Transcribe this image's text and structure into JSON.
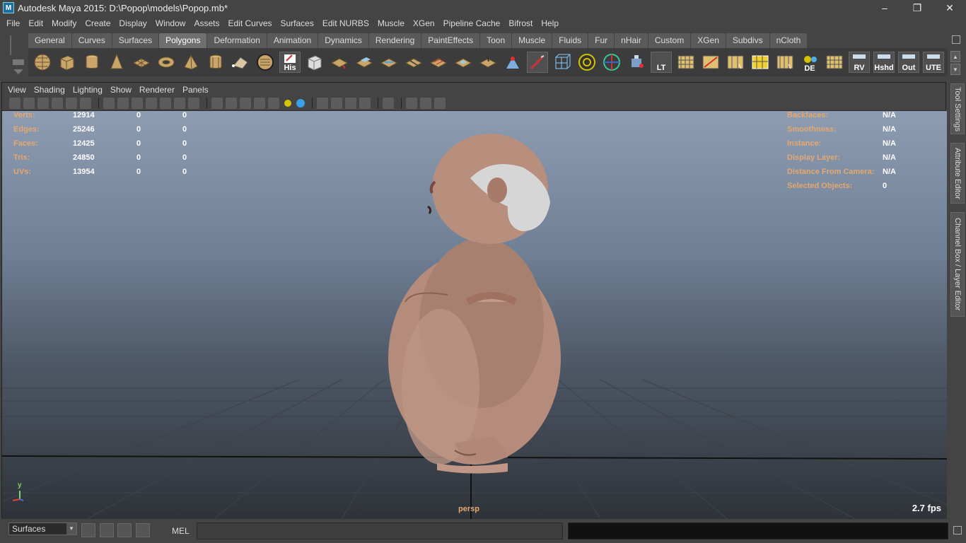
{
  "window": {
    "title": "Autodesk Maya 2015: D:\\Popop\\models\\Popop.mb*",
    "app_icon": "M",
    "minimize": "–",
    "restore": "❐",
    "close": "✕"
  },
  "menubar": {
    "items": [
      "File",
      "Edit",
      "Modify",
      "Create",
      "Display",
      "Window",
      "Assets",
      "Edit Curves",
      "Surfaces",
      "Edit NURBS",
      "Muscle",
      "XGen",
      "Pipeline Cache",
      "Bifrost",
      "Help"
    ]
  },
  "shelf": {
    "tabs": [
      "General",
      "Curves",
      "Surfaces",
      "Polygons",
      "Deformation",
      "Animation",
      "Dynamics",
      "Rendering",
      "PaintEffects",
      "Toon",
      "Muscle",
      "Fluids",
      "Fur",
      "nHair",
      "Custom",
      "XGen",
      "Subdivs",
      "nCloth"
    ],
    "active_tab": "Polygons",
    "icon_labels": {
      "his": "His",
      "lt": "LT",
      "de": "DE",
      "rv": "RV",
      "hshd": "Hshd",
      "out": "Out",
      "ute": "UTE"
    }
  },
  "panel": {
    "menu": [
      "View",
      "Shading",
      "Lighting",
      "Show",
      "Renderer",
      "Panels"
    ]
  },
  "hud_left": [
    {
      "label": "Verts:",
      "v1": "12914",
      "v2": "0",
      "v3": "0"
    },
    {
      "label": "Edges:",
      "v1": "25246",
      "v2": "0",
      "v3": "0"
    },
    {
      "label": "Faces:",
      "v1": "12425",
      "v2": "0",
      "v3": "0"
    },
    {
      "label": "Tris:",
      "v1": "24850",
      "v2": "0",
      "v3": "0"
    },
    {
      "label": "UVs:",
      "v1": "13954",
      "v2": "0",
      "v3": "0"
    }
  ],
  "hud_right": [
    {
      "label": "Backfaces:",
      "value": "N/A"
    },
    {
      "label": "Smoothness:",
      "value": "N/A"
    },
    {
      "label": "Instance:",
      "value": "N/A"
    },
    {
      "label": "Display Layer:",
      "value": "N/A"
    },
    {
      "label": "Distance From Camera:",
      "value": "N/A"
    },
    {
      "label": "Selected Objects:",
      "value": "0"
    }
  ],
  "viewport": {
    "camera": "persp",
    "fps": "2.7 fps",
    "axis_y": "y"
  },
  "side_tabs": [
    "Tool Settings",
    "Attribute Editor",
    "Channel Box / Layer Editor"
  ],
  "bottom": {
    "menu_set": "Surfaces",
    "cmd_label": "MEL"
  }
}
